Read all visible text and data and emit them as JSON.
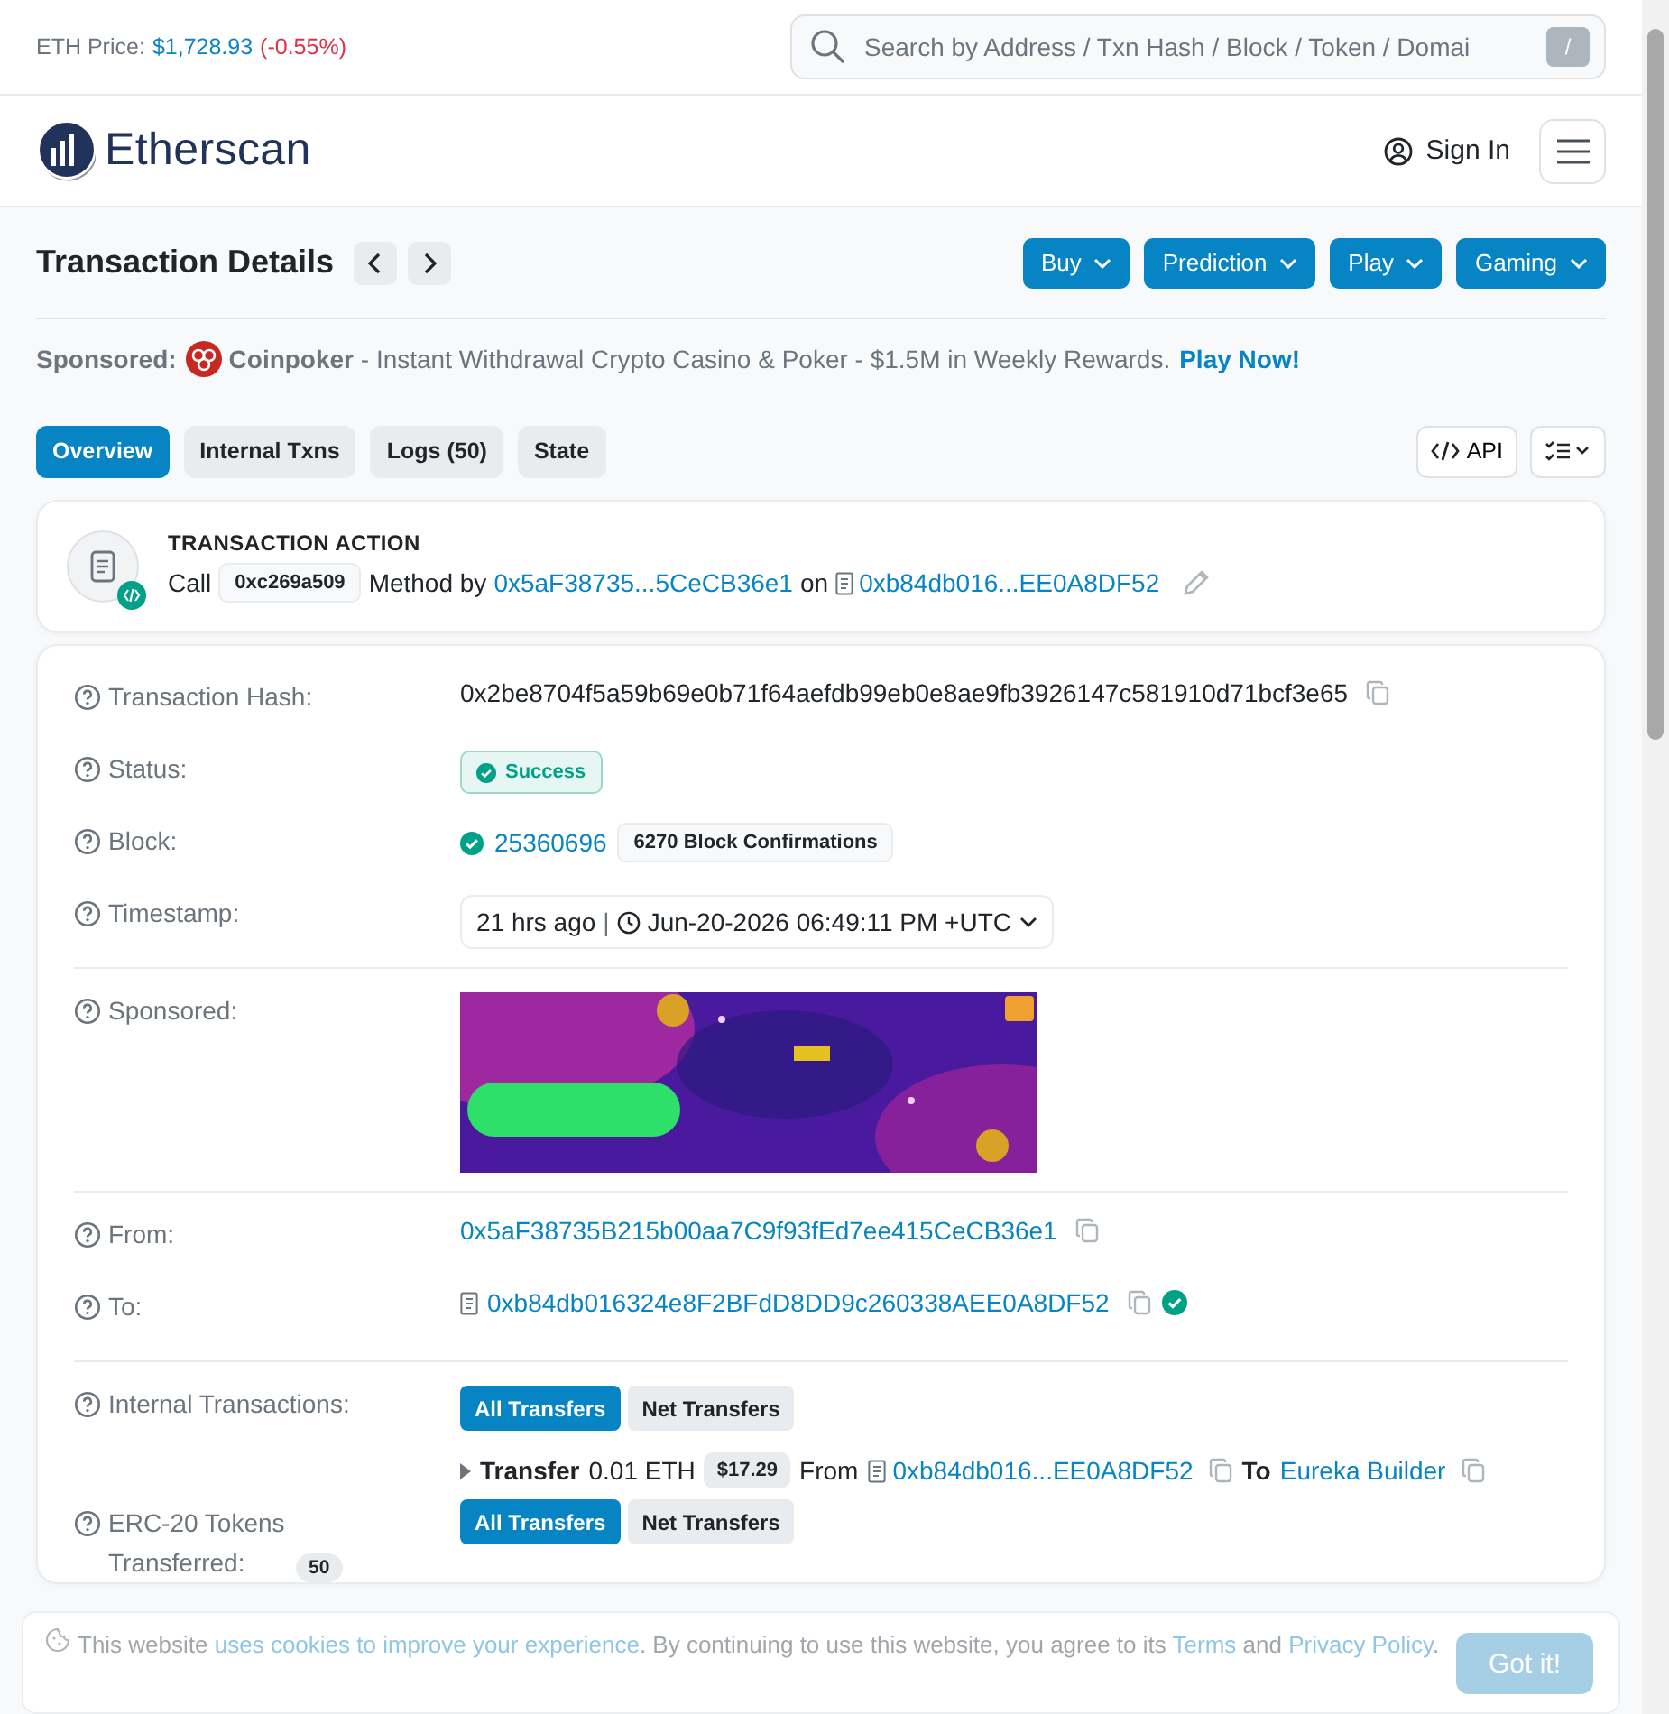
{
  "top_bar": {
    "price_label": "ETH Price:",
    "price": "$1,728.93",
    "change": "(-0.55%)",
    "search": {
      "placeholder": "Search by Address / Txn Hash / Block / Token / Domai",
      "shortcut": "/"
    }
  },
  "header": {
    "logo": "Etherscan",
    "sign_in": "Sign In"
  },
  "page": {
    "title": "Transaction Details",
    "menus": [
      "Buy",
      "Prediction",
      "Play",
      "Gaming"
    ]
  },
  "sponsored": {
    "label": "Sponsored:",
    "text": "**Coinpoker** - Instant Withdrawal Crypto Casino & Poker - $1.5M in Weekly Rewards.",
    "cta": "Play Now!"
  },
  "tabs": [
    {
      "label": "Overview",
      "selected": true
    },
    {
      "label": "Internal Txns",
      "selected": false
    },
    {
      "label": "Logs (50)",
      "selected": false
    },
    {
      "label": "State",
      "selected": false
    }
  ],
  "tools": {
    "api": "API"
  },
  "action": {
    "title": "TRANSACTION ACTION",
    "call": "Call",
    "method": "0xc269a509",
    "method_by": "Method by",
    "from": "0x5aF38735...5CeCB36e1",
    "on": "on",
    "to": "0xb84db016...EE0A8DF52"
  },
  "details": {
    "hash_label": "Transaction Hash:",
    "hash": "0x2be8704f5a59b69e0b71f64aefdb99eb0e8ae9fb3926147c581910d71bcf3e65",
    "status_label": "Status:",
    "status": "Success",
    "block_label": "Block:",
    "block": "25360696",
    "confirmations": "6270 Block Confirmations",
    "timestamp_label": "Timestamp:",
    "age": "21 hrs ago",
    "separator": "|",
    "timestamp": "Jun-20-2026 06:49:11 PM +UTC",
    "sponsored_label": "Sponsored:",
    "from_label": "From:",
    "from": "0x5aF38735B215b00aa7C9f93fEd7ee415CeCB36e1",
    "to_label": "To:",
    "to": "0xb84db016324e8F2BFdD8DD9c260338AEE0A8DF52",
    "internal_label": "Internal Transactions:",
    "internal_filters": [
      {
        "label": "All Transfers",
        "selected": true
      },
      {
        "label": "Net Transfers",
        "selected": false
      }
    ],
    "transfer": {
      "word": "Transfer",
      "amount": "0.01 ETH",
      "usd": "$17.29",
      "from_word": "From",
      "from": "0xb84db016...EE0A8DF52",
      "to_word": "To",
      "to": "Eureka Builder"
    },
    "erc20_label": "ERC-20 Tokens Transferred:",
    "erc20_count": "50",
    "erc20_filters": [
      {
        "label": "All Transfers",
        "selected": true
      },
      {
        "label": "Net Transfers",
        "selected": false
      }
    ]
  },
  "cookie": {
    "before": "This website",
    "link": "uses cookies to improve your experience",
    "middle": ". By continuing to use this website, you agree to its",
    "terms": "Terms",
    "and": "and",
    "privacy": "Privacy Policy",
    "end": ".",
    "button": "Got it!"
  }
}
